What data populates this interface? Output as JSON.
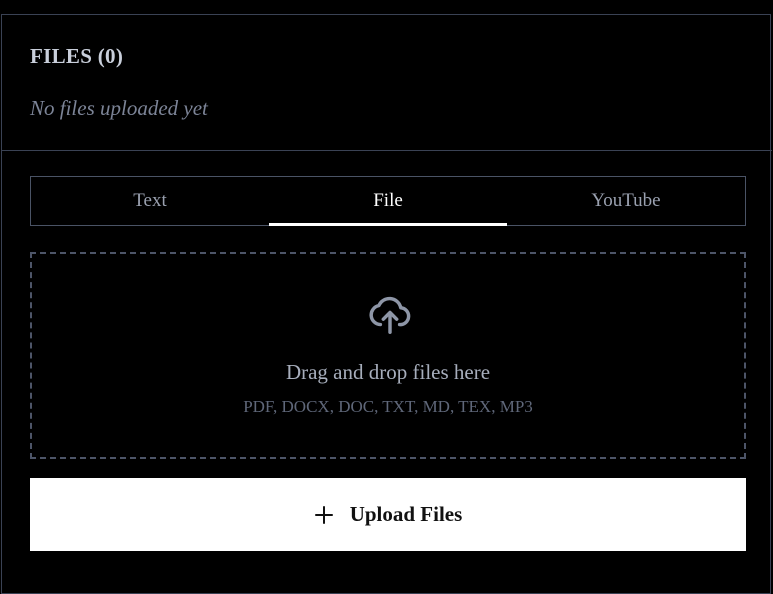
{
  "files": {
    "title": "FILES (0)",
    "empty_message": "No files uploaded yet"
  },
  "tabs": [
    {
      "label": "Text",
      "active": false
    },
    {
      "label": "File",
      "active": true
    },
    {
      "label": "YouTube",
      "active": false
    }
  ],
  "dropzone": {
    "icon": "cloud-upload-icon",
    "title": "Drag and drop files here",
    "formats": "PDF, DOCX, DOC, TXT, MD, TEX, MP3"
  },
  "upload": {
    "icon": "plus-icon",
    "label": "Upload Files"
  },
  "colors": {
    "background": "#000000",
    "border": "#3a4254",
    "active_tab": "#ffffff",
    "button_bg": "#ffffff"
  }
}
